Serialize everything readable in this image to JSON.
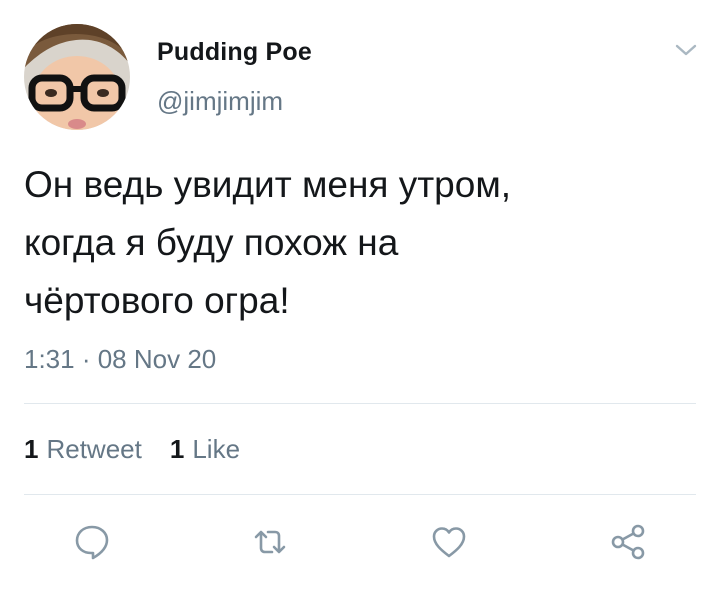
{
  "author": {
    "display_name": "Pudding Poe",
    "handle": "@jimjimjim",
    "avatar_icon": "profile-photo-person-with-glasses"
  },
  "tweet": {
    "text": "Он ведь увидит меня утром,\nкогда я буду похож на\nчёртового огра!",
    "timestamp": "1:31 · 08 Nov 20"
  },
  "stats": {
    "retweets_count": "1",
    "retweets_label": "Retweet",
    "likes_count": "1",
    "likes_label": "Like"
  },
  "actions": [
    {
      "name": "reply",
      "icon": "speech-bubble-icon"
    },
    {
      "name": "retweet",
      "icon": "retweet-icon"
    },
    {
      "name": "like",
      "icon": "heart-icon"
    },
    {
      "name": "share",
      "icon": "share-nodes-icon"
    }
  ],
  "colors": {
    "text_primary": "#14171a",
    "text_secondary": "#657786",
    "icon_gray": "#8899a6",
    "divider": "#e1e8ed"
  }
}
